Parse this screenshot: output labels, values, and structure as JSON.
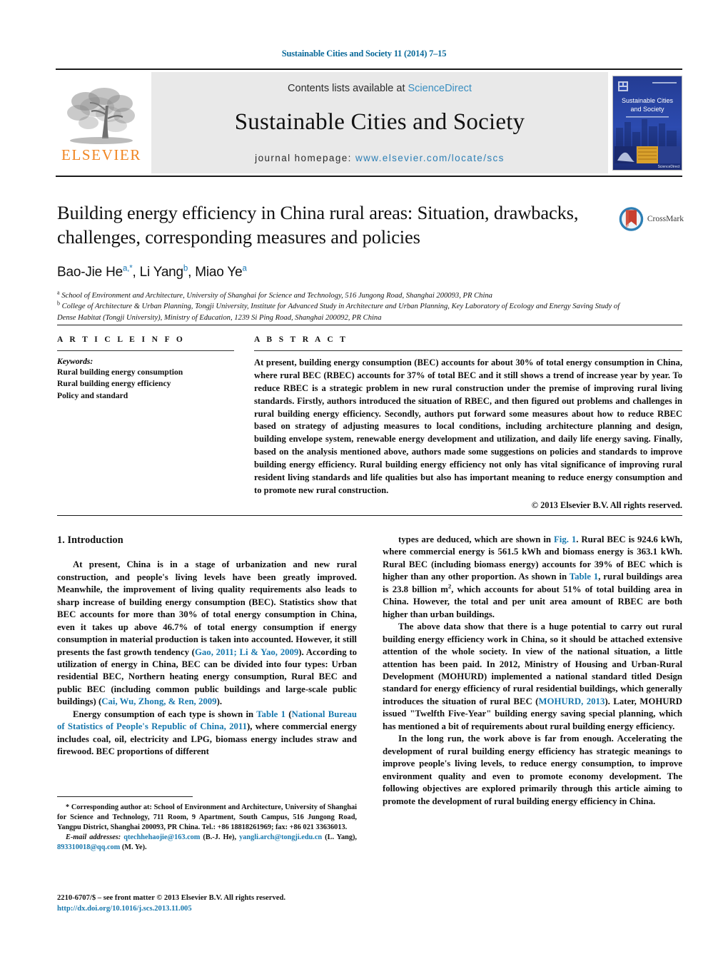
{
  "running_head": "Sustainable Cities and Society 11 (2014) 7–15",
  "masthead": {
    "publisher_name": "ELSEVIER",
    "contents_prefix": "Contents lists available at ",
    "contents_link": "ScienceDirect",
    "journal_title": "Sustainable Cities and Society",
    "homepage_prefix": "journal homepage: ",
    "homepage_url": "www.elsevier.com/locate/scs",
    "cover_title_line1": "Sustainable Cities",
    "cover_title_line2": "and Society"
  },
  "article": {
    "title": "Building energy efficiency in China rural areas: Situation, drawbacks, challenges, corresponding measures and policies",
    "authors_html": "Bao-Jie He<sup>a,*</sup>, Li Yang<sup>b</sup>, Miao Ye<sup>a</sup>",
    "affiliation_a": "School of Environment and Architecture, University of Shanghai for Science and Technology, 516 Jungong Road, Shanghai 200093, PR China",
    "affiliation_b": "College of Architecture & Urban Planning, Tongji University, Institute for Advanced Study in Architecture and Urban Planning, Key Laboratory of Ecology and Energy Saving Study of Dense Habitat (Tongji University), Ministry of Education, 1239 Si Ping Road, Shanghai 200092, PR China",
    "crossmark_label": "CrossMark"
  },
  "info": {
    "heading": "A R T I C L E   I N F O",
    "keywords_label": "Keywords:",
    "keywords": [
      "Rural building energy consumption",
      "Rural building energy efficiency",
      "Policy and standard"
    ]
  },
  "abstract": {
    "heading": "A B S T R A C T",
    "text": "At present, building energy consumption (BEC) accounts for about 30% of total energy consumption in China, where rural BEC (RBEC) accounts for 37% of total BEC and it still shows a trend of increase year by year. To reduce RBEC is a strategic problem in new rural construction under the premise of improving rural living standards. Firstly, authors introduced the situation of RBEC, and then figured out problems and challenges in rural building energy efficiency. Secondly, authors put forward some measures about how to reduce RBEC based on strategy of adjusting measures to local conditions, including architecture planning and design, building envelope system, renewable energy development and utilization, and daily life energy saving. Finally, based on the analysis mentioned above, authors made some suggestions on policies and standards to improve building energy efficiency. Rural building energy efficiency not only has vital significance of improving rural resident living standards and life qualities but also has important meaning to reduce energy consumption and to promote new rural construction.",
    "copyright": "© 2013 Elsevier B.V. All rights reserved."
  },
  "body": {
    "section_heading": "1.  Introduction",
    "left_p1_html": "At present, China is in a stage of urbanization and new rural construction, and people's living levels have been greatly improved. Meanwhile, the improvement of living quality requirements also leads to sharp increase of building energy consumption (BEC). Statistics show that BEC accounts for more than 30% of total energy consumption in China, even it takes up above 46.7% of total energy consumption if energy consumption in material production is taken into accounted. However, it still presents the fast growth tendency (<span class=\"lnk\">Gao, 2011; Li &amp; Yao, 2009</span>). According to utilization of energy in China, BEC can be divided into four types: Urban residential BEC, Northern heating energy consumption, Rural BEC and public BEC (including common public buildings and large-scale public buildings) (<span class=\"lnk\">Cai, Wu, Zhong, &amp; Ren, 2009</span>).",
    "left_p2_html": "Energy consumption of each type is shown in <span class=\"lnk\">Table 1</span> (<span class=\"lnk\">National Bureau of Statistics of People's Republic of China, 2011</span>), where commercial energy includes coal, oil, electricity and LPG, biomass energy includes straw and firewood. BEC proportions of different",
    "right_p1_html": "types are deduced, which are shown in <span class=\"lnk\">Fig. 1</span>. Rural BEC is 924.6 kWh, where commercial energy is 561.5 kWh and biomass energy is 363.1 kWh. Rural BEC (including biomass energy) accounts for 39% of BEC which is higher than any other proportion. As shown in <span class=\"lnk\">Table 1</span>, rural buildings area is 23.8 billion m<sup>2</sup>, which accounts for about 51% of total building area in China. However, the total and per unit area amount of RBEC are both higher than urban buildings.",
    "right_p2_html": "The above data show that there is a huge potential to carry out rural building energy efficiency work in China, so it should be attached extensive attention of the whole society. In view of the national situation, a little attention has been paid. In 2012, Ministry of Housing and Urban-Rural Development (MOHURD) implemented a national standard titled Design standard for energy efficiency of rural residential buildings, which generally introduces the situation of rural BEC (<span class=\"lnk\">MOHURD, 2013</span>). Later, MOHURD issued \"Twelfth Five-Year\" building energy saving special planning, which has mentioned a bit of requirements about rural building energy efficiency.",
    "right_p3_html": "In the long run, the work above is far from enough. Accelerating the development of rural building energy efficiency has strategic meanings to improve people's living levels, to reduce energy consumption, to improve environment quality and even to promote economy development. The following objectives are explored primarily through this article aiming to promote the development of rural building energy efficiency in China."
  },
  "footnote": {
    "corresponding_html": "* Corresponding author at: School of Environment and Architecture, University of Shanghai for Science and Technology, 711 Room, 9 Apartment, South Campus, 516 Jungong Road, Yangpu District, Shanghai 200093, PR China. Tel.: +86 18818261969; fax: +86 021 33636013.",
    "email_html": "<span class=\"em\">E-mail addresses:</span> <span class=\"lnk\">qtechhehaojie@163.com</span> (B.-J. He), <span class=\"lnk\">yangli.arch@tongji.edu.cn</span> (L. Yang), <span class=\"lnk\">893310018@qq.com</span> (M. Ye)."
  },
  "frontmatter": {
    "line1": "2210-6707/$ – see front matter © 2013 Elsevier B.V. All rights reserved.",
    "doi": "http://dx.doi.org/10.1016/j.scs.2013.11.005"
  },
  "colors": {
    "link_blue": "#1878ad",
    "header_blue": "#0b6a9a",
    "elsevier_orange": "#f08521",
    "band_gray": "#e9e9e9"
  }
}
